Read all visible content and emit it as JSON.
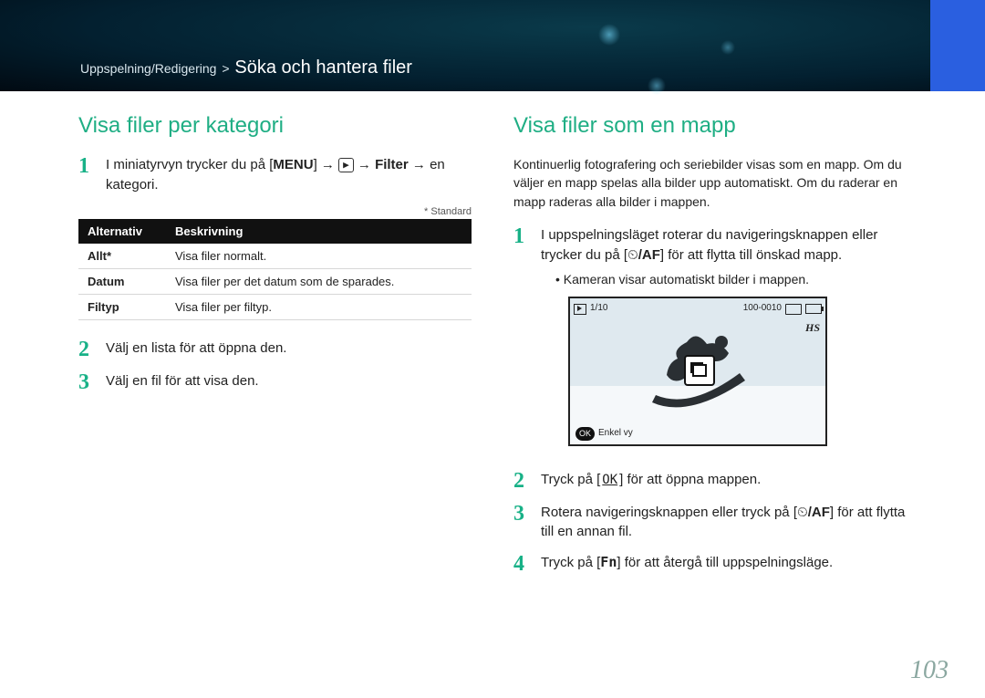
{
  "breadcrumb": {
    "section": "Uppspelning/Redigering",
    "sep": ">",
    "topic": "Söka och hantera filer"
  },
  "left": {
    "heading": "Visa filer per kategori",
    "step1": {
      "pre": "I miniatyrvyn trycker du på [",
      "menu": "MENU",
      "mid1": "] → ",
      "mid2": " → ",
      "filter": "Filter",
      "mid3": " → en kategori."
    },
    "std": "* Standard",
    "table": {
      "h1": "Alternativ",
      "h2": "Beskrivning",
      "rows": [
        {
          "a": "Allt*",
          "b": "Visa filer normalt."
        },
        {
          "a": "Datum",
          "b": "Visa filer per det datum som de sparades."
        },
        {
          "a": "Filtyp",
          "b": "Visa filer per filtyp."
        }
      ]
    },
    "step2": "Välj en lista för att öppna den.",
    "step3": "Välj en fil för att visa den."
  },
  "right": {
    "heading": "Visa filer som en mapp",
    "intro": "Kontinuerlig fotografering och seriebilder visas som en mapp. Om du väljer en mapp spelas alla bilder upp automatiskt. Om du raderar en mapp raderas alla bilder i mappen.",
    "step1": {
      "a": "I uppspelningsläget roterar du navigeringsknappen eller trycker du på [",
      "af": "/AF",
      "b": "] för att flytta till önskad mapp."
    },
    "bullet": "Kameran visar automatiskt bilder i mappen.",
    "screen": {
      "count": "1/10",
      "folder": "100-0010",
      "ok": "OK",
      "mode": "Enkel vy",
      "hs": "HS"
    },
    "step2": {
      "a": "Tryck på [",
      "ok": "OK",
      "b": "] för att öppna mappen."
    },
    "step3": {
      "a": "Rotera navigeringsknappen eller tryck på [",
      "af": "/AF",
      "b": "] för att flytta till en annan fil."
    },
    "step4": {
      "a": "Tryck på [",
      "fn": "Fn",
      "b": "] för att återgå till uppspelningsläge."
    }
  },
  "pageno": "103"
}
